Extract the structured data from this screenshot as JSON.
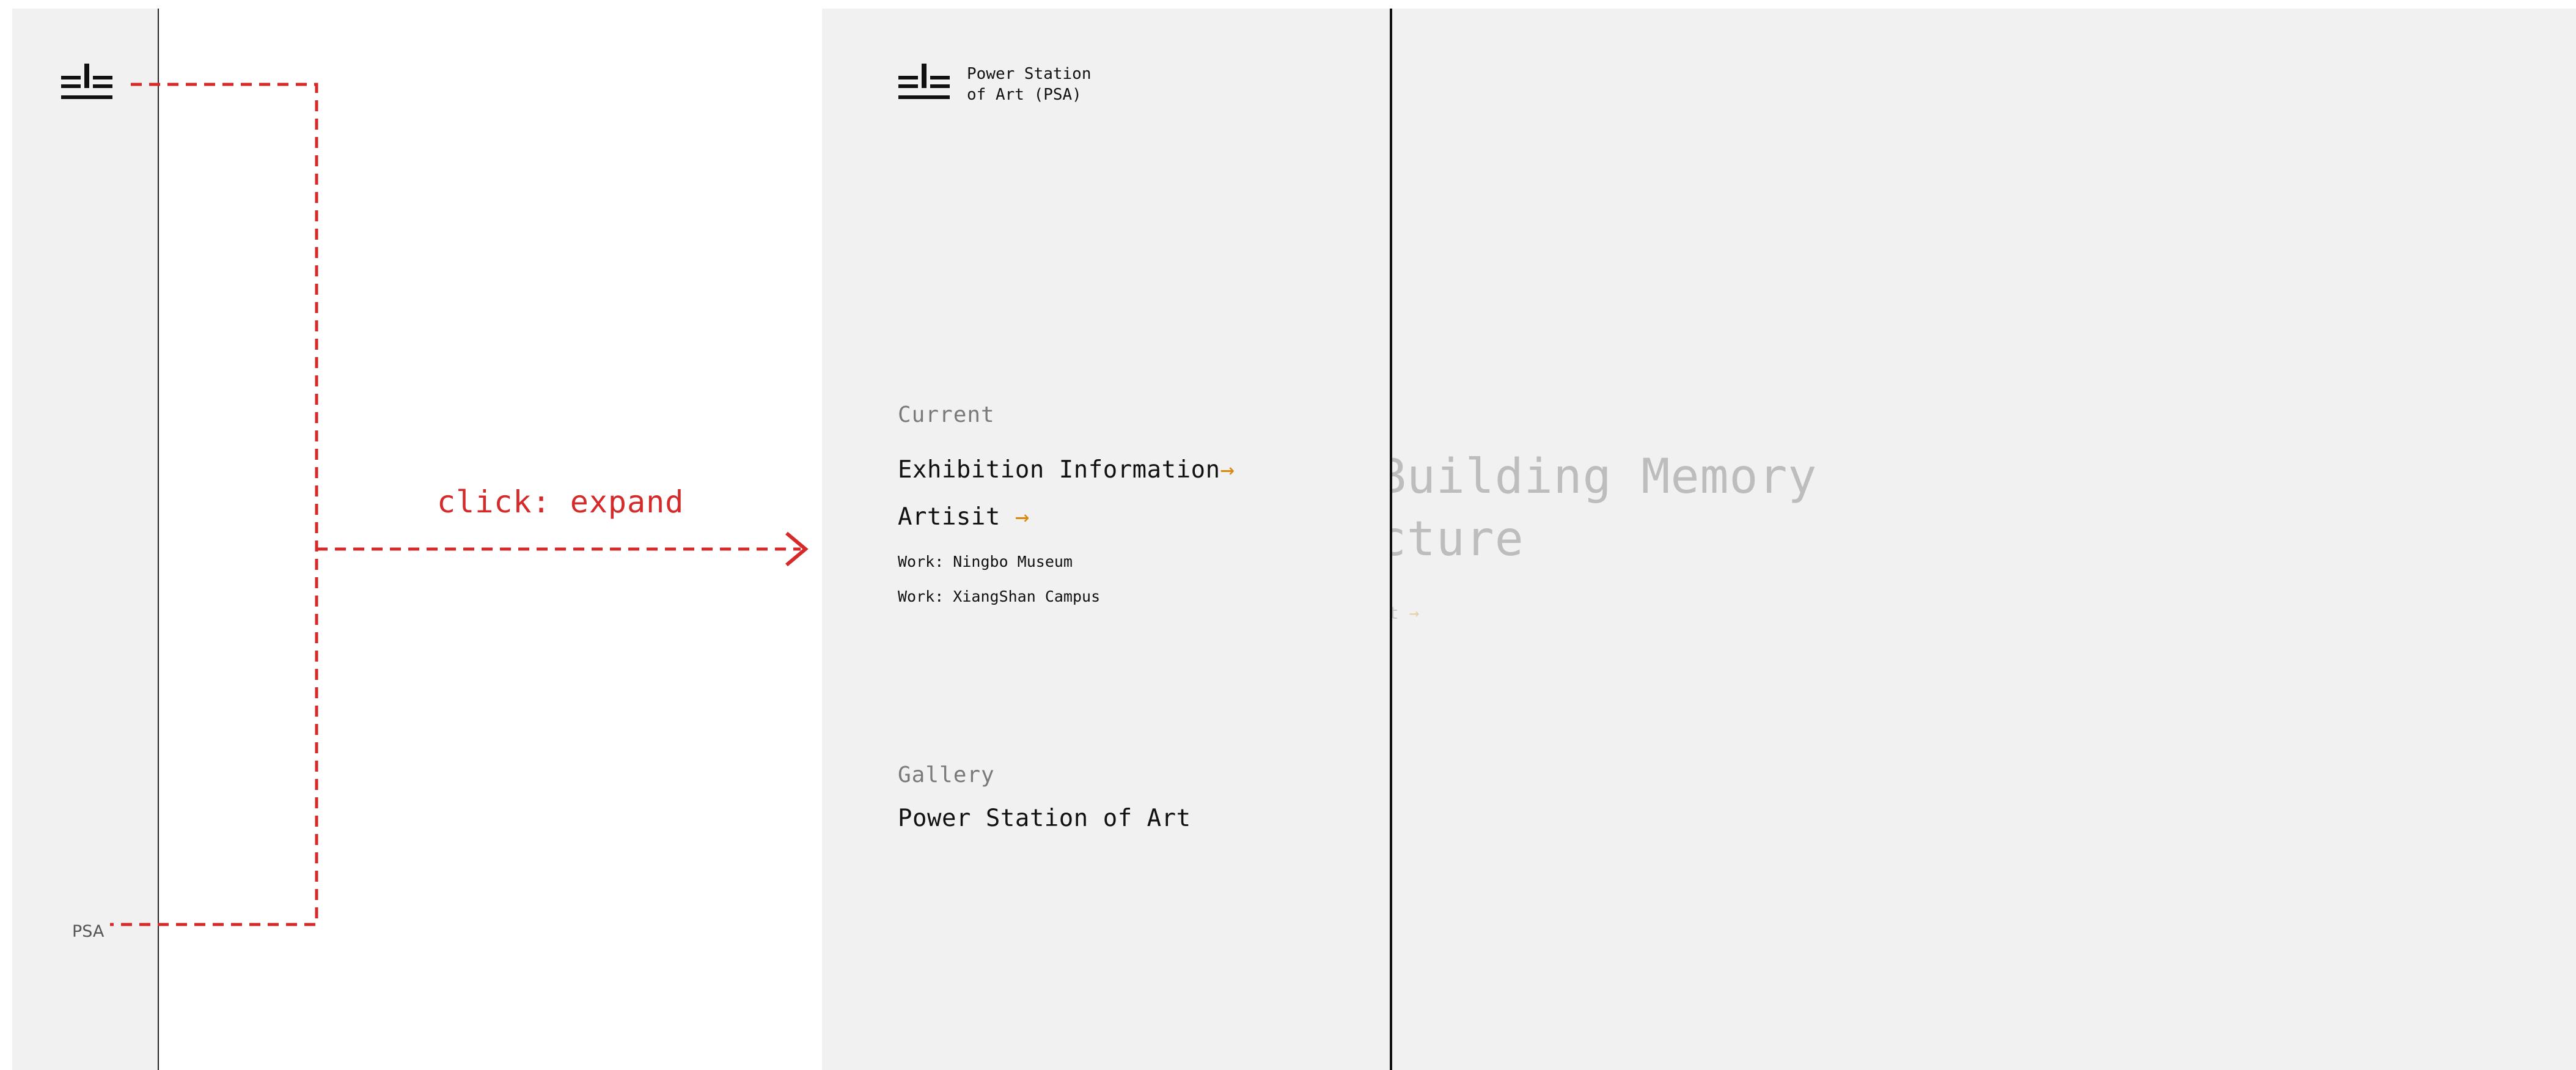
{
  "collapsed": {
    "logo_icon": "psa-logo-icon",
    "label": "PSA"
  },
  "annotation": {
    "label": "click: expand",
    "color": "#d42a2a"
  },
  "expanded": {
    "brand": {
      "logo_icon": "psa-logo-icon",
      "name": "Power Station\nof Art (PSA)"
    },
    "current": {
      "heading": "Current",
      "items": [
        {
          "label": "Exhibition Information",
          "arrow": "→"
        },
        {
          "label": "Artisit",
          "arrow": "→"
        }
      ],
      "sub_items": [
        {
          "label": "Work: Ningbo Museum"
        },
        {
          "label": "Work: XiangShan Campus"
        }
      ]
    },
    "gallery": {
      "heading": "Gallery",
      "item": "Power Station of Art"
    },
    "accent_color": "#d9890f"
  },
  "background": {
    "title_visible": ": Building Memory\ntecture",
    "link_visible": "ist",
    "link_arrow": "→"
  }
}
